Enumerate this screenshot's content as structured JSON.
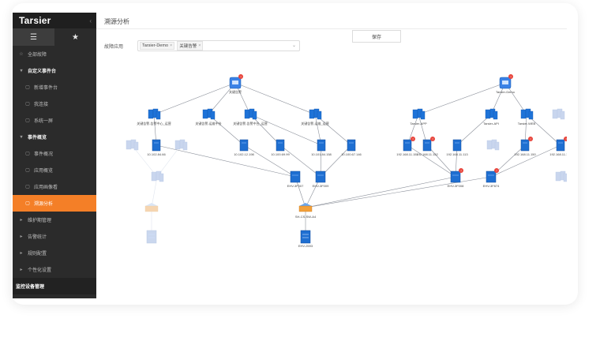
{
  "sidebar": {
    "logo": "Tarsier",
    "collapse_icon": "‹",
    "tabs": [
      {
        "icon": "list-icon",
        "glyph": "☰",
        "active": true
      },
      {
        "icon": "star-icon",
        "glyph": "★",
        "active": false
      }
    ],
    "menu": [
      {
        "label": "全部故障",
        "type": "top",
        "icon": "☆"
      },
      {
        "label": "自定义事件台",
        "type": "group",
        "icon": "▾"
      },
      {
        "label": "新增事件台",
        "type": "sub",
        "icon": "▢"
      },
      {
        "label": "我连接",
        "type": "sub",
        "icon": "▢"
      },
      {
        "label": "系统一屏",
        "type": "sub",
        "icon": "▢"
      },
      {
        "label": "事件概览",
        "type": "group",
        "icon": "▾"
      },
      {
        "label": "事件概况",
        "type": "sub",
        "icon": "▢"
      },
      {
        "label": "应用概览",
        "type": "sub",
        "icon": "▢"
      },
      {
        "label": "应用画像看",
        "type": "sub",
        "icon": "▢"
      },
      {
        "label": "溯源分析",
        "type": "sub",
        "icon": "▢",
        "active": true
      },
      {
        "label": "维护期管理",
        "type": "top",
        "icon": "▸"
      },
      {
        "label": "告警统计",
        "type": "top",
        "icon": "▸"
      },
      {
        "label": "规则配置",
        "type": "top",
        "icon": "▸"
      },
      {
        "label": "个性化设置",
        "type": "top",
        "icon": "▸"
      }
    ],
    "footer": "监控设备管理"
  },
  "main": {
    "title": "溯源分析",
    "save_button": "保存",
    "filter_label": "故障应用",
    "filter_tags": [
      "Tarsier-Demo",
      "关键告警"
    ],
    "caret": "⌄"
  },
  "chart_data": {
    "type": "topology",
    "nodes": [
      {
        "id": "root1",
        "label": "关键告警",
        "kind": "root",
        "alert": "!"
      },
      {
        "id": "root2",
        "label": "Tarsier-Demo",
        "kind": "root",
        "alert": "!"
      },
      {
        "id": "s1",
        "label": "关键告警-告警中心_运营",
        "kind": "service"
      },
      {
        "id": "s2",
        "label": "关键告警-运维中台",
        "kind": "service"
      },
      {
        "id": "s3",
        "label": "关键告警-告警中台_运营",
        "kind": "service"
      },
      {
        "id": "s4",
        "label": "关键告警-运维_运营",
        "kind": "service"
      },
      {
        "id": "g1",
        "label": "",
        "kind": "ghost-server"
      },
      {
        "id": "g2",
        "label": "",
        "kind": "ghost-server"
      },
      {
        "id": "h1",
        "label": "10.102.84.66",
        "kind": "host"
      },
      {
        "id": "h2",
        "label": "10.102.12.198",
        "kind": "host"
      },
      {
        "id": "h3",
        "label": "10.100.69.99",
        "kind": "host"
      },
      {
        "id": "h4",
        "label": "10.101.84.158",
        "kind": "host"
      },
      {
        "id": "h5",
        "label": "10.100.67.146",
        "kind": "host"
      },
      {
        "id": "sw1",
        "label": "EHV-3F007",
        "kind": "switch"
      },
      {
        "id": "sw2",
        "label": "EHV-3F009",
        "kind": "switch"
      },
      {
        "id": "core",
        "label": "SH-CS-SW-A4",
        "kind": "core"
      },
      {
        "id": "stor",
        "label": "EHV-2593",
        "kind": "storage"
      },
      {
        "id": "ga",
        "label": "",
        "kind": "ghost-server"
      },
      {
        "id": "gb",
        "label": "",
        "kind": "ghost-core"
      },
      {
        "id": "gc",
        "label": "",
        "kind": "ghost-storage"
      },
      {
        "id": "t1",
        "label": "Tarsier-APP",
        "kind": "service"
      },
      {
        "id": "t2",
        "label": "Tarsier-API",
        "kind": "service"
      },
      {
        "id": "t3",
        "label": "Tarsier-WEB",
        "kind": "service"
      },
      {
        "id": "gt",
        "label": "",
        "kind": "ghost-server"
      },
      {
        "id": "p1",
        "label": "192.168.11.151",
        "kind": "host",
        "alert": "!"
      },
      {
        "id": "p2",
        "label": "192.168.11.152",
        "kind": "host",
        "alert": "!"
      },
      {
        "id": "p3",
        "label": "192.168.11.113",
        "kind": "host"
      },
      {
        "id": "gp",
        "label": "",
        "kind": "ghost-server"
      },
      {
        "id": "p4",
        "label": "192.168.11.150",
        "kind": "host",
        "alert": "!"
      },
      {
        "id": "p5",
        "label": "192.168.11.155",
        "kind": "host",
        "alert": "!"
      },
      {
        "id": "sw3",
        "label": "EHV-3F008",
        "kind": "switch",
        "alert": "!"
      },
      {
        "id": "sw4",
        "label": "EHV-3F874",
        "kind": "switch",
        "alert": "!"
      },
      {
        "id": "gr",
        "label": "",
        "kind": "ghost-server"
      }
    ],
    "edges": [
      [
        "root1",
        "s1"
      ],
      [
        "root1",
        "s2"
      ],
      [
        "root1",
        "s3"
      ],
      [
        "root1",
        "s4"
      ],
      [
        "s1",
        "h1"
      ],
      [
        "s2",
        "h2"
      ],
      [
        "s3",
        "h3"
      ],
      [
        "s3",
        "h4"
      ],
      [
        "s4",
        "h5"
      ],
      [
        "s4",
        "h4"
      ],
      [
        "h1",
        "sw1"
      ],
      [
        "h2",
        "sw1"
      ],
      [
        "h3",
        "sw2"
      ],
      [
        "h4",
        "sw2"
      ],
      [
        "h5",
        "sw2"
      ],
      [
        "sw1",
        "core"
      ],
      [
        "sw2",
        "core"
      ],
      [
        "core",
        "stor"
      ],
      [
        "root2",
        "t1"
      ],
      [
        "root2",
        "t2"
      ],
      [
        "root2",
        "t3"
      ],
      [
        "t1",
        "p1"
      ],
      [
        "t1",
        "p2"
      ],
      [
        "t2",
        "p3"
      ],
      [
        "t3",
        "p4"
      ],
      [
        "t3",
        "p5"
      ],
      [
        "p1",
        "sw3"
      ],
      [
        "p2",
        "sw3"
      ],
      [
        "p3",
        "sw3"
      ],
      [
        "p4",
        "sw4"
      ],
      [
        "p5",
        "sw4"
      ],
      [
        "sw3",
        "core"
      ],
      [
        "sw4",
        "core"
      ]
    ]
  }
}
